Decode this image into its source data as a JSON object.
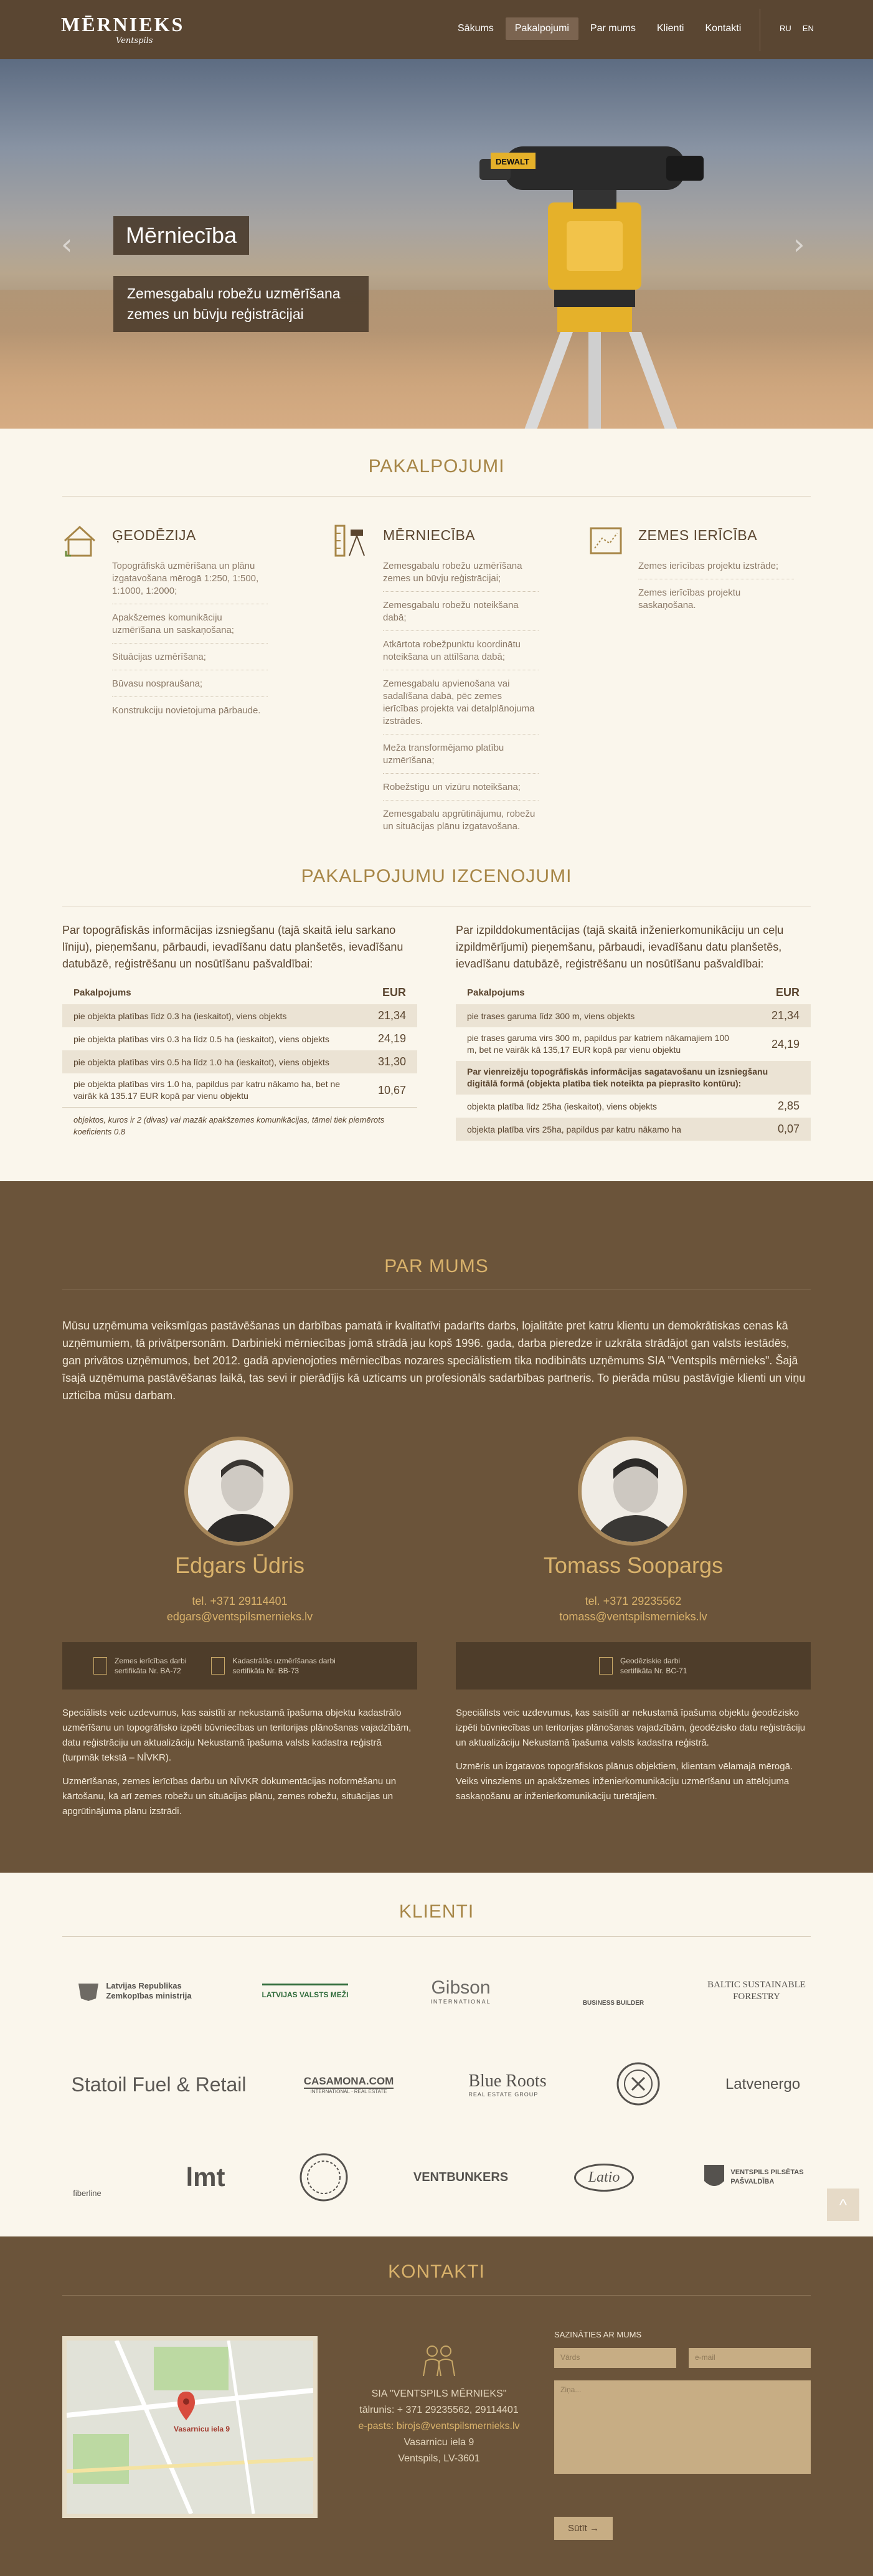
{
  "header": {
    "logo_title": "MĒRNIEKS",
    "logo_sub": "Ventspils",
    "nav": [
      "Sākums",
      "Pakalpojumi",
      "Par mums",
      "Klienti",
      "Kontakti"
    ],
    "lang": [
      "RU",
      "EN"
    ]
  },
  "hero": {
    "title": "Mērniecība",
    "subtitle": "Zemesgabalu robežu uzmērīšana zemes un būvju reģistrācijai",
    "prev": "‹",
    "next": "›",
    "instrument_brand": "DEWALT"
  },
  "services": {
    "title": "PAKALPOJUMI",
    "cols": [
      {
        "icon": "house-icon",
        "title": "ĢEODĒZIJA",
        "items": [
          "Topogrāfiskā uzmērīšana un plānu izgatavošana mērogā 1:250, 1:500, 1:1000, 1:2000;",
          "Apakšzemes komunikāciju uzmērīšana un saskaņošana;",
          "Situācijas uzmērīšana;",
          "Būvasu nospraušana;",
          "Konstrukciju novietojuma pārbaude."
        ]
      },
      {
        "icon": "surveyor-icon",
        "title": "MĒRNIECĪBA",
        "items": [
          "Zemesgabalu robežu uzmērīšana zemes un būvju reģistrācijai;",
          "Zemesgabalu robežu noteikšana dabā;",
          "Atkārtota robežpunktu koordinātu noteikšana un attīlšana dabā;",
          "Zemesgabalu apvienošana vai sadalīšana dabā, pēc zemes ierīcības projekta vai detalplānojuma izstrādes.",
          "Meža transformējamo platību uzmērīšana;",
          "Robežstigu un vizūru noteikšana;",
          "Zemesgabalu apgrūtinājumu, robežu un situācijas plānu izgatavošana."
        ]
      },
      {
        "icon": "land-plan-icon",
        "title": "ZEMES IERĪCĪBA",
        "items": [
          "Zemes ierīcības projektu izstrāde;",
          "Zemes ierīcības projektu saskaņošana."
        ]
      }
    ]
  },
  "pricing": {
    "title": "PAKALPOJUMU IZCENOJUMI",
    "left": {
      "intro": "Par topogrāfiskās informācijas izsniegšanu (tajā skaitā ielu sarkano līniju), pieņemšanu, pārbaudi, ievadīšanu datu planšetēs, ievadīšanu datubāzē, reģistrēšanu un nosūtīšanu pašvaldībai:",
      "col1": "Pakalpojums",
      "col2": "EUR",
      "rows": [
        {
          "label": "pie objekta platības līdz 0.3 ha (ieskaitot), viens objekts",
          "value": "21,34"
        },
        {
          "label": "pie objekta platības virs 0.3 ha līdz 0.5 ha (ieskaitot), viens objekts",
          "value": "24,19"
        },
        {
          "label": "pie objekta platības virs 0.5 ha līdz 1.0 ha (ieskaitot), viens objekts",
          "value": "31,30"
        },
        {
          "label": "pie objekta platības virs 1.0 ha, papildus par katru nākamo ha, bet ne vairāk kā 135.17 EUR kopā par vienu objektu",
          "value": "10,67"
        }
      ],
      "note": "objektos, kuros ir 2 (divas) vai mazāk apakšzemes komunikācijas, tāmei tiek piemērots koeficients 0.8"
    },
    "right": {
      "intro": "Par izpilddokumentācijas (tajā skaitā inženierkomunikāciju un ceļu izpildmērījumi) pieņemšanu, pārbaudi, ievadīšanu datu planšetēs, ievadīšanu datubāzē, reģistrēšanu un nosūtīšanu pašvaldībai:",
      "col1": "Pakalpojums",
      "col2": "EUR",
      "rows": [
        {
          "label": "pie trases garuma līdz 300 m, viens objekts",
          "value": "21,34"
        },
        {
          "label": "pie trases garuma virs 300 m, papildus par katriem nākamajiem 100 m, bet ne vairāk kā 135,17 EUR kopā par vienu objektu",
          "value": "24,19"
        }
      ],
      "subheader": "Par vienreizēju topogrāfiskās informācijas sagatavošanu un izsniegšanu digitālā formā (objekta platība tiek noteikta pa pieprasīto kontūru):",
      "rows2": [
        {
          "label": "objekta platība līdz 25ha (ieskaitot), viens objekts",
          "value": "2,85"
        },
        {
          "label": "objekta platība virs 25ha, papildus par katru nākamo ha",
          "value": "0,07"
        }
      ]
    }
  },
  "about": {
    "title": "PAR MUMS",
    "text": "Mūsu uzņēmuma veiksmīgas pastāvēšanas un darbības pamatā ir kvalitatīvi padarīts darbs, lojalitāte pret katru klientu un demokrātiskas cenas kā uzņēmumiem, tā privātpersonām. Darbinieki mērniecības jomā strādā jau kopš 1996. gada, darba pieredze ir uzkrāta strādājot gan valsts iestādēs, gan privātos uzņēmumos, bet 2012. gadā apvienojoties mērniecības nozares speciālistiem tika nodibināts uzņēmums SIA \"Ventspils mērnieks\". Šajā īsajā uzņēmuma pastāvēšanas laikā, tas sevi ir pierādījis kā uzticams un profesionāls sadarbības partneris. To pierāda mūsu pastāvīgie klienti un viņu uzticība mūsu darbam.",
    "people": [
      {
        "name": "Edgars Ūdris",
        "phone": "tel. +371 29114401",
        "email": "edgars@ventspilsmernieks.lv",
        "certs": [
          {
            "l1": "Zemes ierīcības darbi",
            "l2": "sertifikāta Nr. BA-72"
          },
          {
            "l1": "Kadastrālās uzmērīšanas darbi",
            "l2": "sertifikāta Nr. BB-73"
          }
        ],
        "desc1": "Speciālists veic uzdevumus, kas saistīti ar nekustamā īpašuma objektu kadastrālo uzmērīšanu un topogrāfisko izpēti būvniecības un teritorijas plānošanas vajadzībām, datu reģistrāciju un aktualizāciju Nekustamā īpašuma valsts kadastra reģistrā (turpmāk tekstā – NĪVKR).",
        "desc2": "Uzmērīšanas, zemes ierīcības darbu un NĪVKR dokumentācijas noformēšanu un kārtošanu, kā arī zemes robežu un situācijas plānu, zemes robežu, situācijas un apgrūtinājuma plānu izstrādi."
      },
      {
        "name": "Tomass Soopargs",
        "phone": "tel. +371 29235562",
        "email": "tomass@ventspilsmernieks.lv",
        "certs": [
          {
            "l1": "Ģeodēziskie darbi",
            "l2": "sertifikāta Nr. BC-71"
          }
        ],
        "desc1": "Speciālists veic uzdevumus, kas saistīti ar nekustamā īpašuma objektu ģeodēzisko izpēti būvniecības un teritorijas plānošanas vajadzībām, ģeodēzisko datu reģistrāciju un aktualizāciju Nekustamā īpašuma valsts kadastra reģistrā.",
        "desc2": "Uzmēris un izgatavos topogrāfiskos plānus objektiem, klientam vēlamajā mērogā. Veiks vinsziems un apakšzemes inženierkomunikāciju uzmērīšanu un attēlojuma saskaņošanu ar inženierkomunikāciju turētājiem."
      }
    ]
  },
  "clients": {
    "title": "KLIENTI",
    "logos": [
      {
        "name": "Latvijas Republikas Zemkopības ministrija",
        "lines": [
          "Latvijas Republikas",
          "Zemkopības ministrija"
        ]
      },
      {
        "name": "Latvijas valsts meži",
        "lines": [
          "LATVIJAS VALSTS MEŽI"
        ]
      },
      {
        "name": "Gibson",
        "lines": [
          "Gibson",
          "INTERNATIONAL"
        ]
      },
      {
        "name": "Business Builder",
        "lines": [
          "BUSINESS BUILDER"
        ]
      },
      {
        "name": "Baltic Sustainable Forestry",
        "lines": [
          "BALTIC SUSTAINABLE",
          "FORESTRY"
        ]
      },
      {
        "name": "Statoil Fuel & Retail",
        "lines": [
          "Statoil Fuel & Retail"
        ]
      },
      {
        "name": "Casamona.com",
        "lines": [
          "CASAMONA.COM",
          "INTERNATIONAL · REAL ESTATE"
        ]
      },
      {
        "name": "Blue Roots",
        "lines": [
          "Blue Roots",
          "REAL ESTATE GROUP"
        ]
      },
      {
        "name": "Crest emblem",
        "lines": [
          ""
        ]
      },
      {
        "name": "Latvenergo",
        "lines": [
          "Latvenergo"
        ]
      },
      {
        "name": "fiberline",
        "lines": [
          "fiberline"
        ]
      },
      {
        "name": "lmt",
        "lines": [
          "lmt"
        ]
      },
      {
        "name": "Round seal",
        "lines": [
          ""
        ]
      },
      {
        "name": "Vent Bunkers",
        "lines": [
          "VENTBUNKERS"
        ]
      },
      {
        "name": "Latio",
        "lines": [
          "Latio"
        ]
      },
      {
        "name": "Ventspils pilsētas pašvaldība",
        "lines": [
          "VENTSPILS PILSĒTAS",
          "PAŠVALDĪBA"
        ]
      }
    ],
    "to_top": "^"
  },
  "contacts": {
    "title": "KONTAKTI",
    "map_label": "Vasarnicu iela 9",
    "company": "SIA \"VENTSPILS MĒRNIEKS\"",
    "phones": "tālrunis: + 371 29235562, 29114401",
    "email": "e-pasts: birojs@ventspilsmernieks.lv",
    "street": "Vasarnicu iela 9",
    "city": "Ventspils, LV-3601",
    "form_label": "SAZINĀTIES AR MUMS",
    "ph_name": "Vārds",
    "ph_email": "e-mail",
    "ph_message": "Ziņa...",
    "submit": "Sūtīt →"
  },
  "colors": {
    "brown_dark": "#5a4632",
    "brown": "#6b543a",
    "gold": "#d9b26b",
    "cream": "#faf6ec"
  }
}
